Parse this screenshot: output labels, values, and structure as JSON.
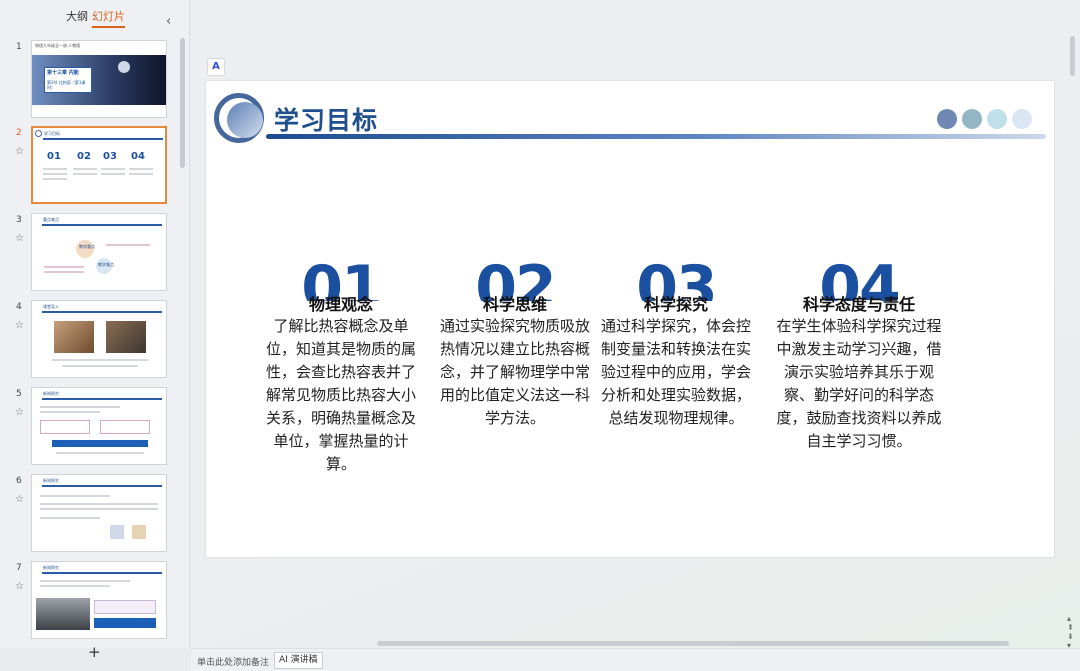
{
  "left_panel": {
    "tabs": {
      "outline": "大纲",
      "slides": "幻灯片"
    },
    "collapse_icon": "chevron-left-icon",
    "thumbnails": [
      {
        "number": "1",
        "title": "第十三章 内能",
        "subtitle": "第3节 比热容（第1课时）",
        "header": "物理九年级全一册·人教版"
      },
      {
        "number": "2",
        "title": "学习目标"
      },
      {
        "number": "3",
        "title": "重点难点",
        "labels": [
          "教学重点",
          "教学难点"
        ]
      },
      {
        "number": "4",
        "title": "课堂导入"
      },
      {
        "number": "5",
        "title": "新知探究"
      },
      {
        "number": "6",
        "title": "新知探究"
      },
      {
        "number": "7",
        "title": "新知探究"
      }
    ],
    "add_slide": "+"
  },
  "slide": {
    "title": "学习目标",
    "dot_colors": [
      "#6f89b4",
      "#94b6c4",
      "#bfe0ea",
      "#dbe6f3"
    ],
    "columns": [
      {
        "number": "01",
        "heading": "物理观念",
        "body": "了解比热容概念及单位，知道其是物质的属性，会查比热容表并了解常见物质比热容大小关系，明确热量概念及单位，掌握热量的计算。"
      },
      {
        "number": "02",
        "heading": "科学思维",
        "body": "通过实验探究物质吸放热情况以建立比热容概念，并了解物理学中常用的比值定义法这一科学方法。"
      },
      {
        "number": "03",
        "heading": "科学探究",
        "body": "通过科学探究，体会控制变量法和转换法在实验过程中的应用，学会分析和处理实验数据，总结发现物理规律。"
      },
      {
        "number": "04",
        "heading": "科学态度与责任",
        "body": "在学生体验科学探究过程中激发主动学习兴趣，借演示实验培养其乐于观察、勤学好问的科学态度，鼓励查找资料以养成自主学习习惯。"
      }
    ]
  },
  "statusbar": {
    "notes_hint": "单击此处添加备注",
    "ai_button": "AI 演讲稿"
  }
}
